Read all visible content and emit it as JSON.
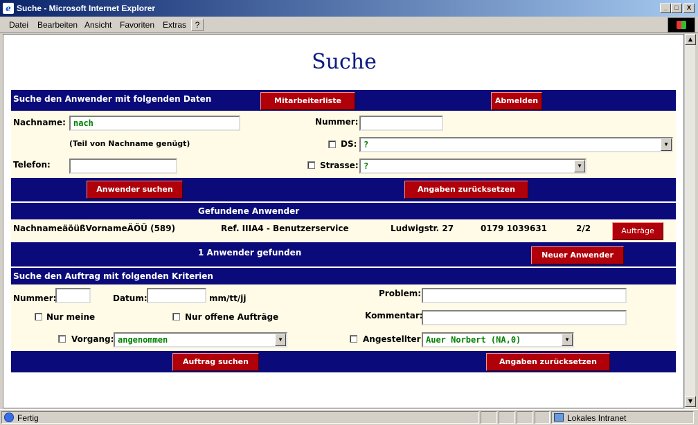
{
  "window": {
    "title": "Suche - Microsoft Internet Explorer",
    "min": "_",
    "max": "□",
    "close": "X"
  },
  "menu": {
    "items": [
      "Datei",
      "Bearbeiten",
      "Ansicht",
      "Favoriten",
      "Extras",
      "?"
    ]
  },
  "page": {
    "title": "Suche"
  },
  "user_search": {
    "header": "Suche den Anwender mit folgenden Daten",
    "staff_list_button": "Mitarbeiterliste",
    "logout_button": "Abmelden",
    "lastname_label": "Nachname:",
    "lastname_value": "nach",
    "lastname_hint": "(Teil von Nachname genügt)",
    "number_label": "Nummer:",
    "number_value": "",
    "ds_label": "DS:",
    "ds_value": "?",
    "phone_label": "Telefon:",
    "phone_value": "",
    "street_label": "Strasse:",
    "street_value": "?",
    "search_button": "Anwender suchen",
    "reset_button": "Angaben zurücksetzen"
  },
  "found_users": {
    "header": "Gefundene Anwender",
    "rows": [
      {
        "name": "NachnameäöüßVornameÄÖÜ (589)",
        "dept": "Ref. IIIA4 - Benutzerservice",
        "street": "Ludwigstr. 27",
        "phone": "0179 1039631",
        "count": "2/2",
        "orders_button": "Aufträge"
      }
    ],
    "summary": "1 Anwender gefunden",
    "new_user_button": "Neuer Anwender"
  },
  "order_search": {
    "header": "Suche den Auftrag mit folgenden Kriterien",
    "number_label": "Nummer:",
    "number_value": "",
    "date_label": "Datum:",
    "date_value": "",
    "date_format": "mm/tt/jj",
    "problem_label": "Problem:",
    "problem_value": "",
    "only_mine_label": "Nur meine",
    "only_open_label": "Nur offene Aufträge",
    "comment_label": "Kommentar:",
    "comment_value": "",
    "process_label": "Vorgang:",
    "process_value": "angenommen",
    "employee_label": "Angestellter:",
    "employee_value": "Auer Norbert (NA,0)",
    "search_button": "Auftrag suchen",
    "reset_button": "Angaben zurücksetzen"
  },
  "statusbar": {
    "status": "Fertig",
    "zone": "Lokales Intranet"
  }
}
